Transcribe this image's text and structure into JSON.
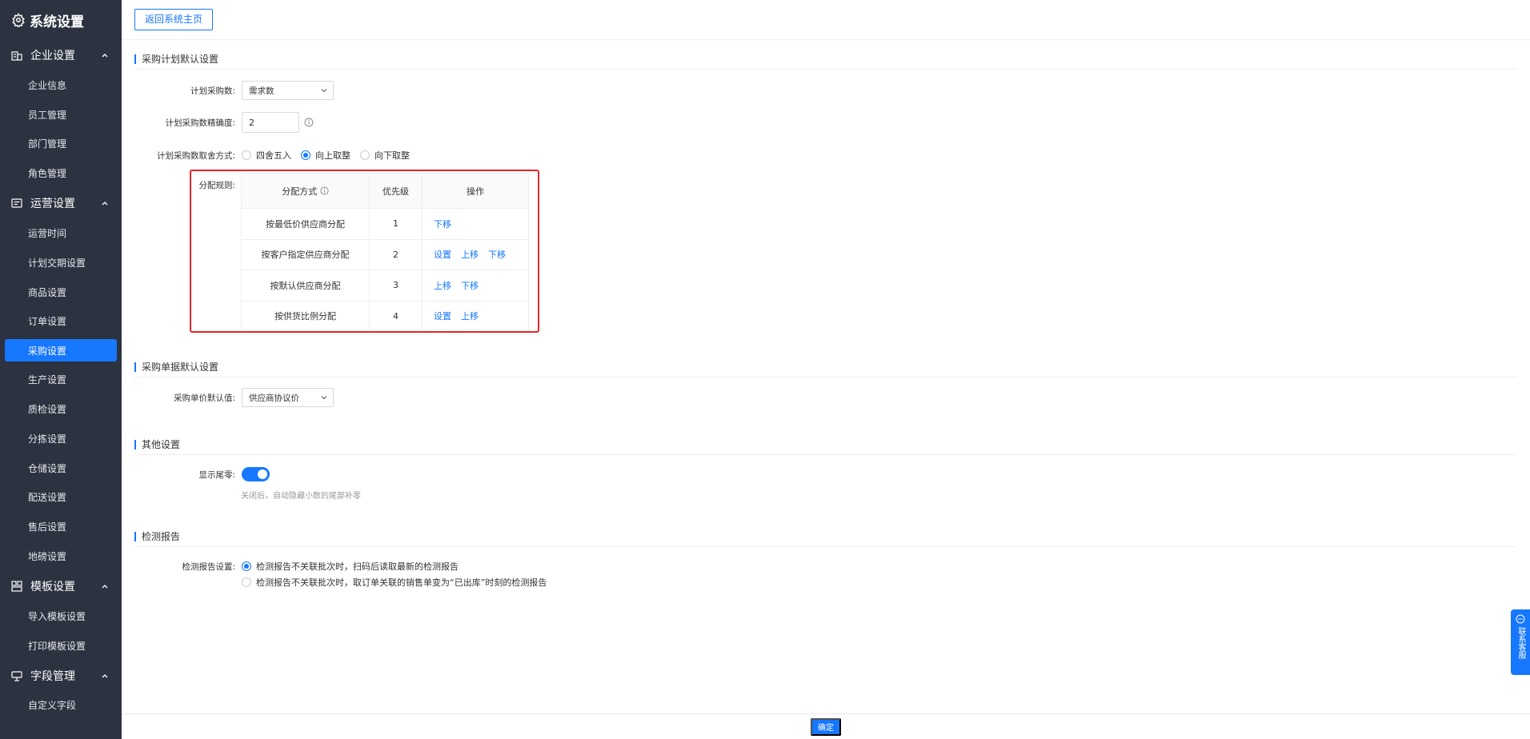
{
  "sidebar": {
    "title": "系统设置",
    "groups": [
      {
        "label": "企业设置",
        "items": [
          "企业信息",
          "员工管理",
          "部门管理",
          "角色管理"
        ]
      },
      {
        "label": "运营设置",
        "items": [
          "运营时间",
          "计划交期设置",
          "商品设置",
          "订单设置",
          "采购设置",
          "生产设置",
          "质检设置",
          "分拣设置",
          "仓储设置",
          "配送设置",
          "售后设置",
          "地磅设置"
        ]
      },
      {
        "label": "模板设置",
        "items": [
          "导入模板设置",
          "打印模板设置"
        ]
      },
      {
        "label": "字段管理",
        "items": [
          "自定义字段"
        ]
      }
    ],
    "active_item": "采购设置"
  },
  "topbar": {
    "back_label": "返回系统主页"
  },
  "plan": {
    "title": "采购计划默认设置",
    "qty_label": "计划采购数:",
    "qty_value": "需求数",
    "precision_label": "计划采购数精确度:",
    "precision_value": "2",
    "rounding_label": "计划采购数取舍方式:",
    "rounding_options": [
      "四舍五入",
      "向上取整",
      "向下取整"
    ],
    "rounding_selected": "向上取整",
    "rule_label": "分配规则:",
    "table_headers": [
      "分配方式",
      "优先级",
      "操作"
    ],
    "rules": [
      {
        "name": "按最低价供应商分配",
        "priority": "1",
        "ops": [
          "下移"
        ]
      },
      {
        "name": "按客户指定供应商分配",
        "priority": "2",
        "ops": [
          "设置",
          "上移",
          "下移"
        ]
      },
      {
        "name": "按默认供应商分配",
        "priority": "3",
        "ops": [
          "上移",
          "下移"
        ]
      },
      {
        "name": "按供货比例分配",
        "priority": "4",
        "ops": [
          "设置",
          "上移"
        ]
      }
    ]
  },
  "doc": {
    "title": "采购单据默认设置",
    "price_label": "采购单价默认值:",
    "price_value": "供应商协议价"
  },
  "other": {
    "title": "其他设置",
    "tail_label": "显示尾零:",
    "tail_on": true,
    "tail_hint": "关闭后，自动隐藏小数的尾部补零"
  },
  "report": {
    "title": "检测报告",
    "setting_label": "检测报告设置:",
    "options": [
      "检测报告不关联批次时，扫码后读取最新的检测报告",
      "检测报告不关联批次时，取订单关联的销售单变为“已出库”时刻的检测报告"
    ],
    "selected_index": 0
  },
  "footer": {
    "ok_label": "确定"
  },
  "customer_service": {
    "label": "联系客服"
  },
  "colors": {
    "accent": "#1677ff",
    "sidebar_bg": "#2c3240",
    "highlight": "#e5252a"
  }
}
